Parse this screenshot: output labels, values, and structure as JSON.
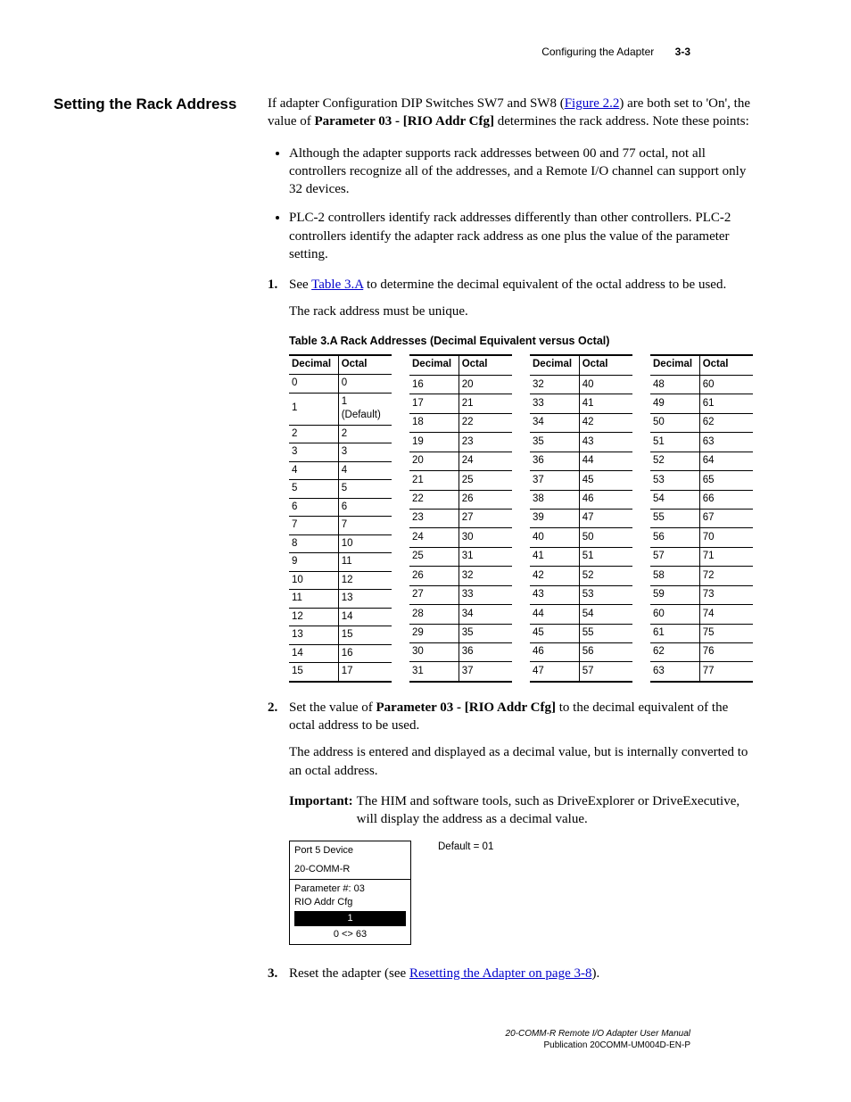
{
  "header": {
    "chapter": "Configuring the Adapter",
    "pagenum": "3-3"
  },
  "section_heading": "Setting the Rack Address",
  "intro": {
    "pre": "If adapter Configuration DIP Switches SW7 and SW8 (",
    "figref": "Figure 2.2",
    "mid": ") are both set to 'On', the value of ",
    "param": "Parameter 03 - [RIO Addr Cfg]",
    "post": " determines the rack address. Note these points:"
  },
  "bullets": [
    "Although the adapter supports rack addresses between 00 and 77 octal, not all controllers recognize all of the addresses, and a Remote I/O channel can support only 32 devices.",
    "PLC-2 controllers identify rack addresses differently than other controllers. PLC-2 controllers identify the adapter rack address as one plus the value of the parameter setting."
  ],
  "step1": {
    "num": "1.",
    "pre": "See ",
    "ref": "Table 3.A",
    "post": " to determine the decimal equivalent of the octal address to be used."
  },
  "unique": "The rack address must be unique.",
  "table_caption": "Table 3.A   Rack Addresses (Decimal Equivalent versus Octal)",
  "table_headers": {
    "dec": "Decimal",
    "oct": "Octal"
  },
  "chart_data": {
    "type": "table",
    "columns": [
      "Decimal",
      "Octal"
    ],
    "groups": [
      [
        [
          "0",
          "0"
        ],
        [
          "1",
          "1 (Default)"
        ],
        [
          "2",
          "2"
        ],
        [
          "3",
          "3"
        ],
        [
          "4",
          "4"
        ],
        [
          "5",
          "5"
        ],
        [
          "6",
          "6"
        ],
        [
          "7",
          "7"
        ],
        [
          "8",
          "10"
        ],
        [
          "9",
          "11"
        ],
        [
          "10",
          "12"
        ],
        [
          "11",
          "13"
        ],
        [
          "12",
          "14"
        ],
        [
          "13",
          "15"
        ],
        [
          "14",
          "16"
        ],
        [
          "15",
          "17"
        ]
      ],
      [
        [
          "16",
          "20"
        ],
        [
          "17",
          "21"
        ],
        [
          "18",
          "22"
        ],
        [
          "19",
          "23"
        ],
        [
          "20",
          "24"
        ],
        [
          "21",
          "25"
        ],
        [
          "22",
          "26"
        ],
        [
          "23",
          "27"
        ],
        [
          "24",
          "30"
        ],
        [
          "25",
          "31"
        ],
        [
          "26",
          "32"
        ],
        [
          "27",
          "33"
        ],
        [
          "28",
          "34"
        ],
        [
          "29",
          "35"
        ],
        [
          "30",
          "36"
        ],
        [
          "31",
          "37"
        ]
      ],
      [
        [
          "32",
          "40"
        ],
        [
          "33",
          "41"
        ],
        [
          "34",
          "42"
        ],
        [
          "35",
          "43"
        ],
        [
          "36",
          "44"
        ],
        [
          "37",
          "45"
        ],
        [
          "38",
          "46"
        ],
        [
          "39",
          "47"
        ],
        [
          "40",
          "50"
        ],
        [
          "41",
          "51"
        ],
        [
          "42",
          "52"
        ],
        [
          "43",
          "53"
        ],
        [
          "44",
          "54"
        ],
        [
          "45",
          "55"
        ],
        [
          "46",
          "56"
        ],
        [
          "47",
          "57"
        ]
      ],
      [
        [
          "48",
          "60"
        ],
        [
          "49",
          "61"
        ],
        [
          "50",
          "62"
        ],
        [
          "51",
          "63"
        ],
        [
          "52",
          "64"
        ],
        [
          "53",
          "65"
        ],
        [
          "54",
          "66"
        ],
        [
          "55",
          "67"
        ],
        [
          "56",
          "70"
        ],
        [
          "57",
          "71"
        ],
        [
          "58",
          "72"
        ],
        [
          "59",
          "73"
        ],
        [
          "60",
          "74"
        ],
        [
          "61",
          "75"
        ],
        [
          "62",
          "76"
        ],
        [
          "63",
          "77"
        ]
      ]
    ]
  },
  "step2": {
    "num": "2.",
    "pre": "Set the value of ",
    "param": "Parameter 03 - [RIO Addr Cfg]",
    "post": " to the decimal equivalent of the octal address to be used."
  },
  "step2_note": "The address is entered and displayed as a decimal value, but is internally converted to an octal address.",
  "important": {
    "label": "Important:",
    "text": "The HIM and software tools, such as DriveExplorer or DriveExecutive, will display the address as a decimal value."
  },
  "him": {
    "line1": "Port 5 Device",
    "line2": "20-COMM-R",
    "line3": "Parameter #: 03",
    "line4": "RIO Addr Cfg",
    "value": "1",
    "range": "0 <> 63",
    "default": "Default = 01"
  },
  "step3": {
    "num": "3.",
    "pre": "Reset the adapter (see ",
    "ref": "Resetting the Adapter on page 3-8",
    "post": ")."
  },
  "footer": {
    "title": "20-COMM-R Remote I/O Adapter User Manual",
    "pub": "Publication 20COMM-UM004D-EN-P"
  }
}
